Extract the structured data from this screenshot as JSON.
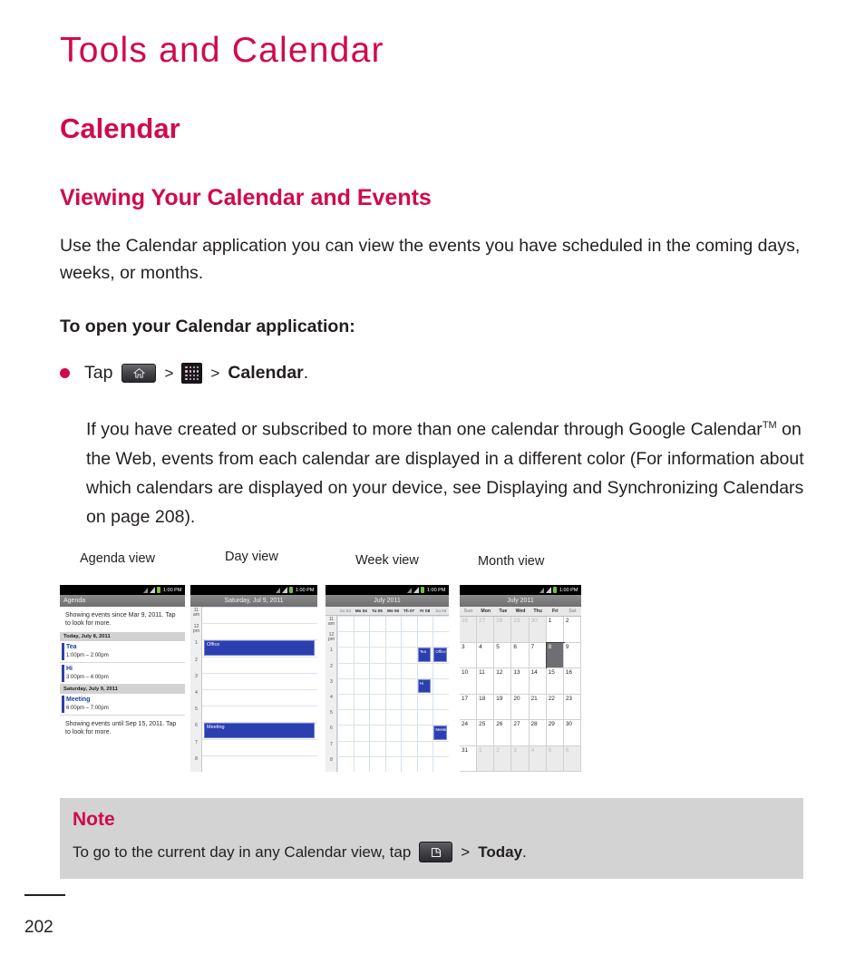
{
  "chapter": {
    "title": "Tools and Calendar"
  },
  "headings": {
    "h1": "Calendar",
    "h2": "Viewing Your Calendar and Events"
  },
  "body": {
    "intro": "Use the Calendar application you can view the events you have scheduled in the coming days, weeks, or months.",
    "subhead": "To open your Calendar application:",
    "bullet": {
      "tap": "Tap",
      "sep1": ">",
      "sep2": ">",
      "target": "Calendar",
      "period": "."
    },
    "indent_para_1": "If you have created or subscribed to more than one calendar through Google Calendar",
    "indent_tm": "TM",
    "indent_para_2": " on the Web, events from each calendar are displayed in a different color (For information about which calendars are displayed on your device, see Displaying and Synchronizing Calendars on page 208)."
  },
  "icons": {
    "home": "home-key-icon",
    "apps": "apps-grid-icon",
    "menu": "menu-key-icon"
  },
  "figures": {
    "labels": [
      "Agenda view",
      "Day view",
      "Week view",
      "Month view"
    ],
    "status_time": "1:00 PM",
    "agenda": {
      "title": "Agenda",
      "note_top": "Showing events since Mar 9, 2011. Tap to look for more.",
      "note_bottom": "Showing events until Sep 15, 2011. Tap to look for more.",
      "groups": [
        {
          "day": "Today, July 8, 2011",
          "events": [
            {
              "title": "Tea",
              "hours": "1:00pm – 2:00pm"
            },
            {
              "title": "Hi",
              "hours": "3:00pm – 4:00pm"
            }
          ]
        },
        {
          "day": "Saturday, July 9, 2011",
          "events": [
            {
              "title": "Meeting",
              "hours": "6:00pm – 7:00pm"
            }
          ]
        }
      ]
    },
    "day": {
      "title": "Saturday, Jul 9, 2011",
      "hours": [
        "11 am",
        "12 pm",
        "1",
        "2",
        "3",
        "4",
        "5",
        "6",
        "7",
        "8"
      ],
      "events": [
        {
          "title": "Office",
          "start_hour": "1",
          "duration": "1"
        },
        {
          "title": "Meeting",
          "start_hour": "6",
          "duration": "1"
        }
      ]
    },
    "week": {
      "title": "July 2011",
      "days": [
        "Su 03",
        "Mo 04",
        "Tu 05",
        "We 06",
        "Th 07",
        "Fr 08",
        "Sa 09"
      ],
      "hours": [
        "11 am",
        "12 pm",
        "1",
        "2",
        "3",
        "4",
        "5",
        "6",
        "7",
        "8"
      ],
      "events": [
        {
          "title": "Tea",
          "day_index": "5",
          "start_hour": "1"
        },
        {
          "title": "Office",
          "day_index": "6",
          "start_hour": "1"
        },
        {
          "title": "Hi",
          "day_index": "5",
          "start_hour": "3"
        },
        {
          "title": "Meeting",
          "day_index": "6",
          "start_hour": "6"
        }
      ]
    },
    "month": {
      "title": "July 2011",
      "weekdays": [
        "Sun",
        "Mon",
        "Tue",
        "Wed",
        "Thu",
        "Fri",
        "Sat"
      ],
      "selected_day": "8",
      "cells": [
        {
          "n": "26",
          "o": true
        },
        {
          "n": "27",
          "o": true
        },
        {
          "n": "28",
          "o": true
        },
        {
          "n": "29",
          "o": true
        },
        {
          "n": "30",
          "o": true
        },
        {
          "n": "1",
          "o": false
        },
        {
          "n": "2",
          "o": false
        },
        {
          "n": "3",
          "o": false
        },
        {
          "n": "4",
          "o": false
        },
        {
          "n": "5",
          "o": false
        },
        {
          "n": "6",
          "o": false
        },
        {
          "n": "7",
          "o": false
        },
        {
          "n": "8",
          "o": false
        },
        {
          "n": "9",
          "o": false
        },
        {
          "n": "10",
          "o": false
        },
        {
          "n": "11",
          "o": false
        },
        {
          "n": "12",
          "o": false
        },
        {
          "n": "13",
          "o": false
        },
        {
          "n": "14",
          "o": false
        },
        {
          "n": "15",
          "o": false
        },
        {
          "n": "16",
          "o": false
        },
        {
          "n": "17",
          "o": false
        },
        {
          "n": "18",
          "o": false
        },
        {
          "n": "19",
          "o": false
        },
        {
          "n": "20",
          "o": false
        },
        {
          "n": "21",
          "o": false
        },
        {
          "n": "22",
          "o": false
        },
        {
          "n": "23",
          "o": false
        },
        {
          "n": "24",
          "o": false
        },
        {
          "n": "25",
          "o": false
        },
        {
          "n": "26",
          "o": false
        },
        {
          "n": "27",
          "o": false
        },
        {
          "n": "28",
          "o": false
        },
        {
          "n": "29",
          "o": false
        },
        {
          "n": "30",
          "o": false
        },
        {
          "n": "31",
          "o": false
        },
        {
          "n": "1",
          "o": true
        },
        {
          "n": "2",
          "o": true
        },
        {
          "n": "3",
          "o": true
        },
        {
          "n": "4",
          "o": true
        },
        {
          "n": "5",
          "o": true
        },
        {
          "n": "6",
          "o": true
        }
      ]
    }
  },
  "note": {
    "title": "Note",
    "text_before": "To go to the current day in any Calendar view, tap",
    "sep": ">",
    "action": "Today",
    "period": "."
  },
  "footer": {
    "page_number": "202"
  },
  "colors": {
    "brand": "#d00a4e",
    "note_bg": "#d3d3d3",
    "event_blue": "#2b3fb0",
    "text": "#231f20"
  }
}
